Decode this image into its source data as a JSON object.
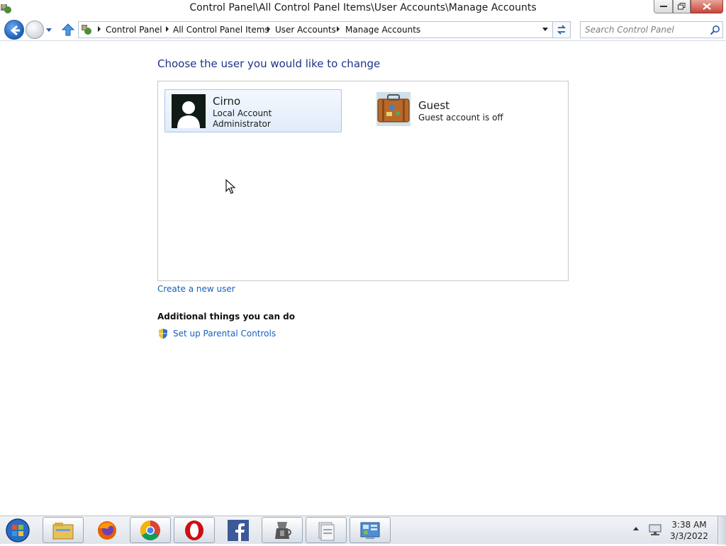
{
  "window": {
    "title": "Control Panel\\All Control Panel Items\\User Accounts\\Manage Accounts"
  },
  "navbar": {
    "breadcrumbs": [
      "Control Panel",
      "All Control Panel Items",
      "User Accounts",
      "Manage Accounts"
    ],
    "search_placeholder": "Search Control Panel"
  },
  "main": {
    "heading": "Choose the user you would like to change",
    "accounts": [
      {
        "name": "Cirno",
        "lines": [
          "Local Account",
          "Administrator"
        ],
        "icon": "user-silhouette-icon",
        "selected": true
      },
      {
        "name": "Guest",
        "lines": [
          "Guest account is off"
        ],
        "icon": "suitcase-icon",
        "selected": false
      }
    ],
    "create_link": "Create a new user",
    "additional_heading": "Additional things you can do",
    "parental_link": "Set up Parental Controls"
  },
  "taskbar": {
    "apps": [
      "file-explorer-icon",
      "firefox-icon",
      "chrome-icon",
      "opera-icon",
      "facebook-icon",
      "coffee-maker-icon",
      "documents-icon",
      "control-panel-icon"
    ],
    "clock_time": "3:38 AM",
    "clock_date": "3/3/2022"
  },
  "colors": {
    "heading": "#1e3287",
    "link": "#1560bd",
    "selected_tile": "#e1ecfa"
  }
}
